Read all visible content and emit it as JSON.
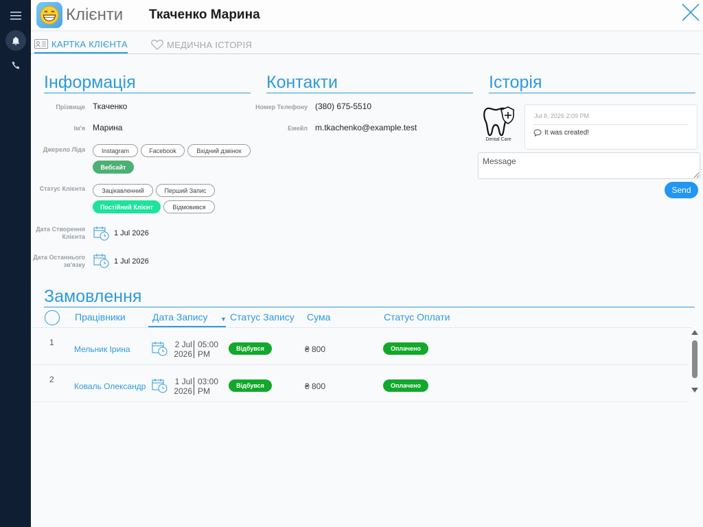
{
  "colors": {
    "accent": "#2f9ad9",
    "rail": "#0f1e33",
    "green": "#11a82b",
    "mint": "#1de39b",
    "lead_green": "#4caf73",
    "send": "#2196f3"
  },
  "header": {
    "app_title": "Клієнти",
    "client_name": "Ткаченко Марина",
    "logo_icon": "grinning-face-icon",
    "close_icon": "close-icon"
  },
  "rail": {
    "menu_icon": "hamburger-icon",
    "bell_icon": "bell-icon",
    "phone_icon": "phone-icon"
  },
  "tabs": [
    {
      "label": "КАРТКА КЛІЄНТА",
      "icon": "id-card-icon",
      "active": true
    },
    {
      "label": "МЕДИЧНА ІСТОРІЯ",
      "icon": "heart-icon",
      "active": false
    }
  ],
  "info": {
    "heading": "Інформація",
    "surname_label": "Прізвище",
    "surname": "Ткаченко",
    "name_label": "Ім'я",
    "name": "Марина",
    "lead_label": "Джерело Ліда",
    "lead_options": [
      "Instagram",
      "Facebook",
      "Вхідний дзвінок",
      "Вебсайт"
    ],
    "lead_selected": "Вебсайт",
    "status_label": "Статус Клієнта",
    "status_options": [
      "Зацікавленний",
      "Перший Запис",
      "Постійний Клієнт",
      "Відмовився"
    ],
    "status_selected": "Постійний Клієнт",
    "created_label_1": "Дата Створення",
    "created_label_2": "Клієнта",
    "created": "1 Jul 2026",
    "last_label_1": "Дата Останнього",
    "last_label_2": "зв'язку",
    "last": "1 Jul 2026"
  },
  "contacts": {
    "heading": "Контакти",
    "phone_label": "Номер Телефону",
    "phone": "(380) 675-5510",
    "email_label": "Емейл",
    "email": "m.tkachenko@example.test"
  },
  "history": {
    "heading": "Історія",
    "author": "Dental Care",
    "time": "Jul 8, 2026 2:09 PM",
    "text": "It was created!",
    "message_placeholder": "Message",
    "send_label": "Send"
  },
  "orders": {
    "heading": "Замовлення",
    "columns": [
      "Працівники",
      "Дата Запису",
      "Статус Запису",
      "Сума",
      "Статус Оплати"
    ],
    "rows": [
      {
        "idx": "1",
        "worker": "Мельник Ірина",
        "date_1": "2 Jul",
        "date_2": "2026",
        "time_1": "05:00",
        "time_2": "PM",
        "status": "Відбувся",
        "amount": "₴ 800",
        "payment": "Оплачено"
      },
      {
        "idx": "2",
        "worker": "Коваль Олександр",
        "date_1": "1 Jul",
        "date_2": "2026",
        "time_1": "03:00",
        "time_2": "PM",
        "status": "Відбувся",
        "amount": "₴ 800",
        "payment": "Оплачено"
      }
    ]
  }
}
